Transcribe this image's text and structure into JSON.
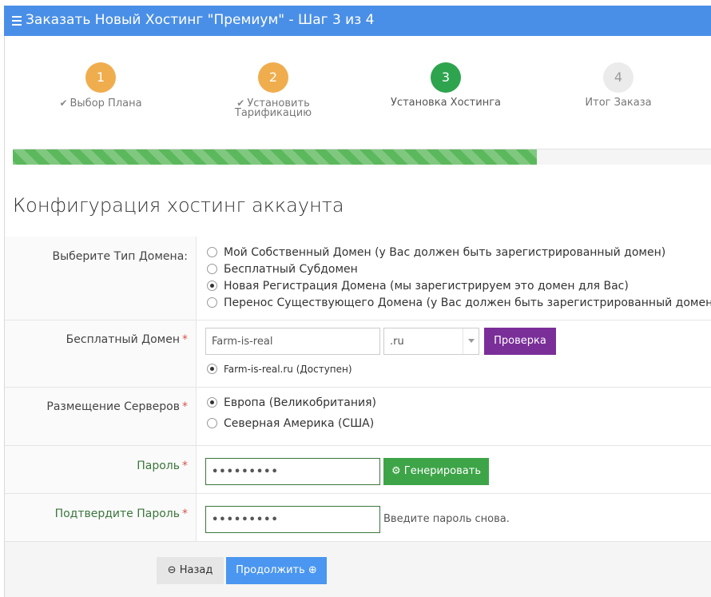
{
  "header": {
    "title": "Заказать Новый Хостинг \"Премиум\" - Шаг 3 из 4"
  },
  "steps": [
    {
      "number": "1",
      "label": "Выбор Плана",
      "done": true
    },
    {
      "number": "2",
      "label": "Установить Тарификацию",
      "done": true
    },
    {
      "number": "3",
      "label": "Установка Хостинга",
      "done": false
    },
    {
      "number": "4",
      "label": "Итог Заказа",
      "done": false
    }
  ],
  "progress": {
    "percent": 75
  },
  "section_title": "Конфигурация хостинг аккаунта",
  "domain_type": {
    "label": "Выберите Тип Домена:",
    "options": [
      "Мой Собственный Домен (у Вас должен быть зарегистрированный домен)",
      "Бесплатный Субдомен",
      "Новая Регистрация Домена (мы зарегистрируем это домен для Вас)",
      "Перенос Существующего Домена (у Вас должен быть зарегистрированный домен)"
    ],
    "selected_index": 2
  },
  "free_domain": {
    "label": "Бесплатный Домен",
    "required_mark": "*",
    "name_value": "Farm-is-real",
    "tld_value": ".ru",
    "check_button": "Проверка",
    "result": "Farm-is-real.ru (Доступен)"
  },
  "server_location": {
    "label": "Размещение Серверов",
    "required_mark": "*",
    "options": [
      "Европа (Великобритания)",
      "Северная Америка (США)"
    ],
    "selected_index": 0
  },
  "password": {
    "label": "Пароль",
    "required_mark": "*",
    "value": "•••••••••",
    "generate_button": "Генерировать"
  },
  "confirm_password": {
    "label": "Подтвердите Пароль",
    "required_mark": "*",
    "value": "•••••••••",
    "hint": "Введите пароль снова."
  },
  "footer": {
    "back_button": "Назад",
    "continue_button": "Продолжить"
  },
  "colors": {
    "header": "#4a8fe7",
    "done_step": "#f0ad4e",
    "active_step": "#2ea44f",
    "progress": "#5cb85c",
    "check_button": "#7a2f98",
    "generate_button": "#3ea448",
    "continue_button": "#4a96f0"
  },
  "icons": {
    "menu": "hamburger-icon",
    "check": "checkmark-icon",
    "gear": "gear-icon",
    "back": "circle-arrow-left-icon",
    "forward": "circle-arrow-right-icon"
  }
}
